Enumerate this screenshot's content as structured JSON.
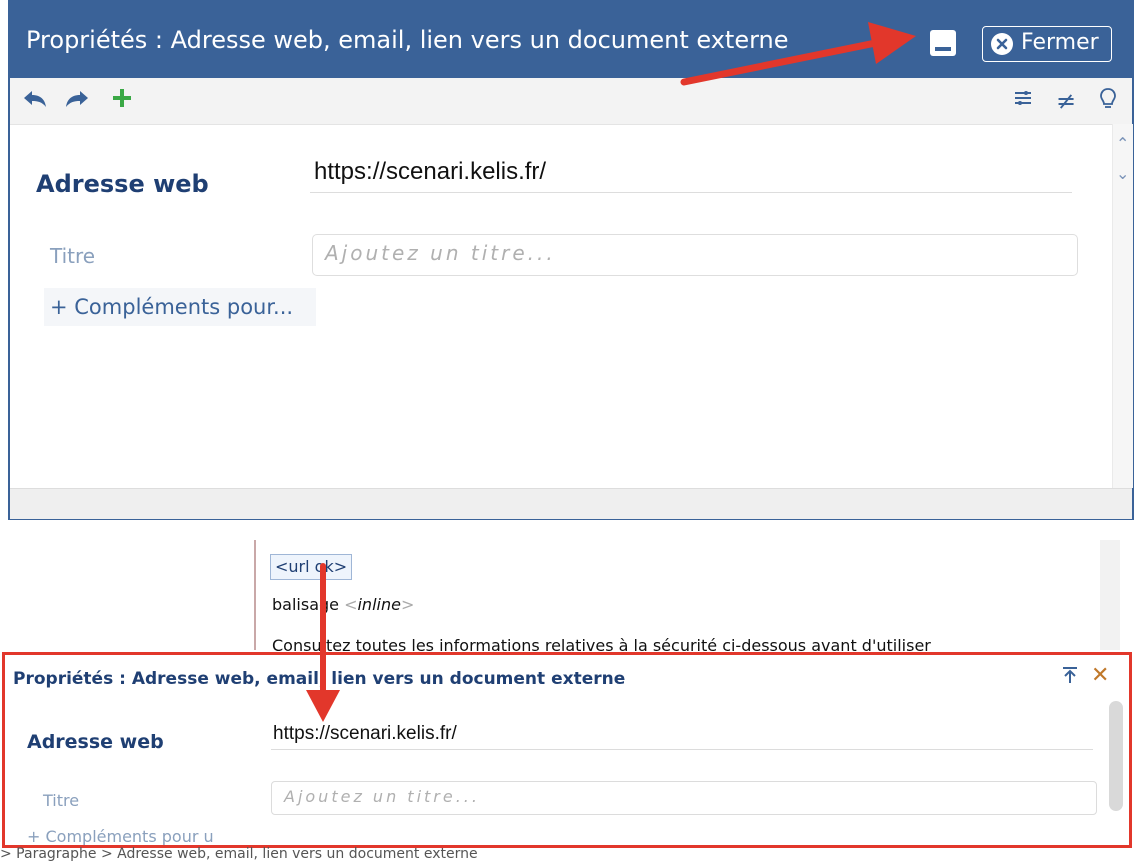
{
  "top_dialog": {
    "title": "Propriétés : Adresse web, email, lien vers un document externe",
    "close_label": "Fermer",
    "web_label": "Adresse web",
    "web_value": "https://scenari.kelis.fr/",
    "title_label": "Titre",
    "title_placeholder": "Ajoutez un titre...",
    "complements_label": "+ Compléments pour..."
  },
  "editor": {
    "url_tag": "<url ok>",
    "balisage_text": "balisage ",
    "inline_tag": "inline",
    "consultez_text": "Consultez toutes les informations relatives à la sécurité ci-dessous avant d'utiliser"
  },
  "bottom_panel": {
    "title": "Propriétés : Adresse web, email, lien vers un document externe",
    "web_label": "Adresse web",
    "web_value": "https://scenari.kelis.fr/",
    "title_label": "Titre",
    "title_placeholder": "Ajoutez un titre...",
    "complements_label": "+ Compléments pour u"
  },
  "breadcrumb": "> Paragraphe > Adresse web, email, lien vers un document externe",
  "colors": {
    "header_blue": "#3a6298",
    "label_blue": "#1f3f73",
    "annotation_red": "#e2372b",
    "add_green": "#3aa845"
  },
  "icons": [
    "undo-icon",
    "redo-icon",
    "add-icon",
    "options-icon",
    "not-equal-icon",
    "lightbulb-icon",
    "save-icon",
    "close-circle-icon",
    "pin-top-icon",
    "close-x-icon"
  ]
}
